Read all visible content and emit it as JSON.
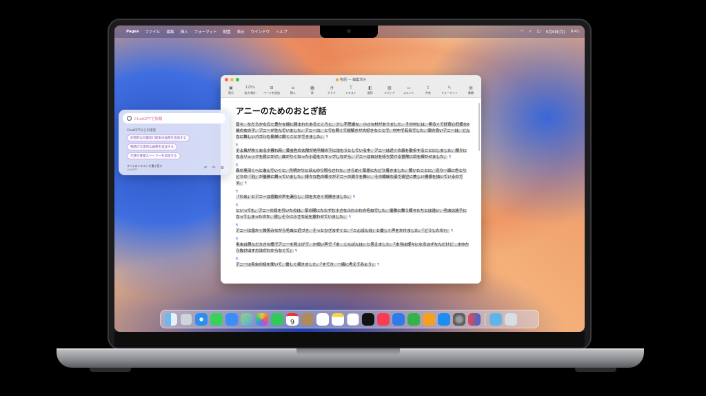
{
  "menubar": {
    "app_name": "Pages",
    "items": [
      "ファイル",
      "編集",
      "挿入",
      "フォーマット",
      "配置",
      "表示",
      "ウインドウ",
      "ヘルプ"
    ],
    "date": "9月9日(月)",
    "time": "9:41"
  },
  "window": {
    "title": "物語",
    "subtitle": "— 編集済み",
    "zoom": "125%",
    "toolbar": [
      "表示",
      "拡大/縮小",
      "ページを追加",
      "挿入",
      "表",
      "グラフ",
      "テキスト",
      "図形",
      "メディア",
      "コメント",
      "共有",
      "フォーマット",
      "書類"
    ]
  },
  "document": {
    "heading": "アニーのためのおとぎ話",
    "paragraphs": [
      "昔々、なだらかな丘と豊かな緑に囲まれたあるところに、少し不思議な、小さな村がありました。その村には、明るくて好奇心旺盛な6歳の女の子、アニーが住んでいました。アニーは、とても賢くて謎解きが大好きなことで、村中で有名でした。頭の良いアニーは、どんなに難しいパズルも簡単に解くことができました。",
      "そよ風が吹くある夕暮れ時、黄金色の太陽が地平線の下に沈もうとしている中、アニーは近くの森を散歩することにしました。頼りになるリュックを肩にかけ、曲がりくねった小道をスキップしながら、アニーは自分を待ち受ける冒険に目を輝かせました。",
      "森の奥深くへと進んでいくと、月明かりにほんのり照らされた、きらめく草原にたどり着きました。驚いたことに、辺り一面に色とりどりの「羽」が優雅に舞っていました。様々な色の蝶々がアニーの周りを舞い、その繊細な姿で夜空に美しい模様を描いているのです。",
      "「わあ」とアニーは感動の声を漏らし、目を大きく見開きました。",
      "といっても、アニーの目を引いたのは、草の間にたたずむ小さなふわふわの毛虫でした。優雅に舞う蝶々たちとは違い、毛虫は迷子になってしまったのか、寂しそうに小さな足を震わせていました。",
      "アニーは温かく微笑みながら毛虫に近づき、そっとひざまずくと、「こんばんは」と優しく声をかけました。「どうしたの?」",
      "毛虫は潤んだ大きな瞳でアニーを見上げて、か細い声で「あ…こんばんは」と答えました。「本当は蝶々になるはずなんだけど…まゆから抜け出す方法がわからなくて」",
      "アニーは毛虫の話を聞いて、優しく頷きました。「すてき、一緒に考えてみよう」"
    ]
  },
  "chatgpt": {
    "placeholder": "ChatGPTで依頼",
    "source_label": "ChatGPTからの提案",
    "suggestions": [
      "幻想的な児童向け絵本の画像を追加する",
      "物語の写実的な画像を追加する",
      "代替の冒頭ストーリーを追加する"
    ],
    "footer_main": "すべてのテキストを書き直す",
    "footer_sub": "ChatGPT"
  },
  "dock": {
    "apps": [
      "finder",
      "launchpad",
      "safari",
      "messages",
      "mail",
      "maps",
      "photos",
      "facetime",
      "calendar",
      "contacts",
      "reminders",
      "notes",
      "freeform",
      "tv",
      "music",
      "keynote",
      "numbers",
      "pages",
      "app-store",
      "system-settings",
      "iphone-mirroring"
    ],
    "calendar_day": "9"
  },
  "colors": {
    "selection": "#d9d9d9",
    "pilcrow": "#4a7bd8",
    "suggestion_text": "#7d3fb5"
  }
}
